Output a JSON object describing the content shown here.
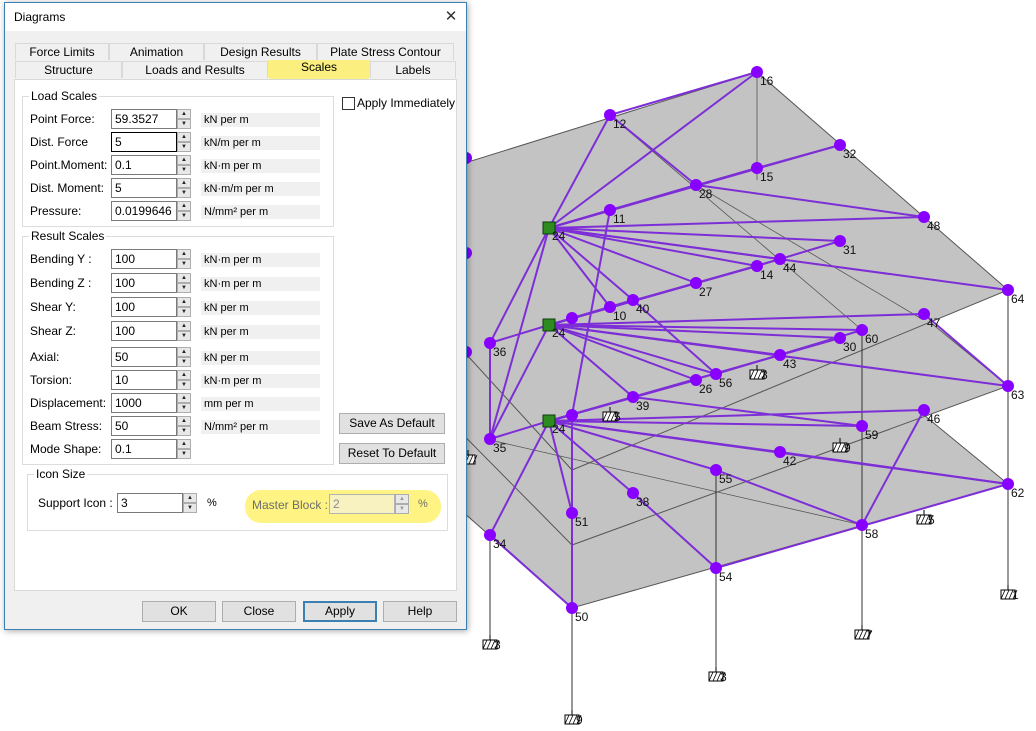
{
  "dialog": {
    "title": "Diagrams",
    "close_glyph": "✕",
    "tabs_row1": [
      "Force Limits",
      "Animation",
      "Design Results",
      "Plate Stress Contour"
    ],
    "tabs_row2": [
      "Structure",
      "Loads and Results",
      "Scales",
      "Labels"
    ],
    "active_tab": "Scales",
    "apply_immediately_label": "Apply Immediately",
    "apply_immediately_checked": false,
    "load_scales": {
      "title": "Load Scales",
      "rows": [
        {
          "label": "Point Force:",
          "value": "59.3527",
          "unit": "kN per m"
        },
        {
          "label": "Dist. Force",
          "value": "5",
          "unit": "kN/m per m"
        },
        {
          "label": "Point.Moment:",
          "value": "0.1",
          "unit": "kN·m per m"
        },
        {
          "label": "Dist. Moment:",
          "value": "5",
          "unit": "kN·m/m per m"
        },
        {
          "label": "Pressure:",
          "value": "0.0199646",
          "unit": "N/mm² per m"
        }
      ]
    },
    "result_scales": {
      "title": "Result Scales",
      "rows": [
        {
          "label": "Bending Y :",
          "value": "100",
          "unit": "kN·m per m"
        },
        {
          "label": "Bending Z :",
          "value": "100",
          "unit": "kN·m per m"
        },
        {
          "label": "Shear Y:",
          "value": "100",
          "unit": "kN per m"
        },
        {
          "label": "Shear Z:",
          "value": "100",
          "unit": "kN per m"
        },
        {
          "label": "Axial:",
          "value": "50",
          "unit": "kN per m"
        },
        {
          "label": "Torsion:",
          "value": "10",
          "unit": "kN·m per m"
        },
        {
          "label": "Displacement:",
          "value": "1000",
          "unit": "mm per m"
        },
        {
          "label": "Beam Stress:",
          "value": "50",
          "unit": "N/mm² per m"
        },
        {
          "label": "Mode Shape:",
          "value": "0.1",
          "unit": ""
        }
      ]
    },
    "icon_size": {
      "title": "Icon Size",
      "support_label": "Support Icon :",
      "support_value": "3",
      "support_unit": "%",
      "master_label": "Master Block :",
      "master_value": "2",
      "master_unit": "%"
    },
    "save_default_label": "Save As Default",
    "reset_default_label": "Reset To Default",
    "buttons": {
      "ok": "OK",
      "close": "Close",
      "apply": "Apply",
      "help": "Help"
    }
  },
  "model": {
    "colors": {
      "node": "#8800ff",
      "member": "#7d2ed6",
      "slab": "#c3c3c3",
      "master": "#2e8b1f"
    }
  }
}
